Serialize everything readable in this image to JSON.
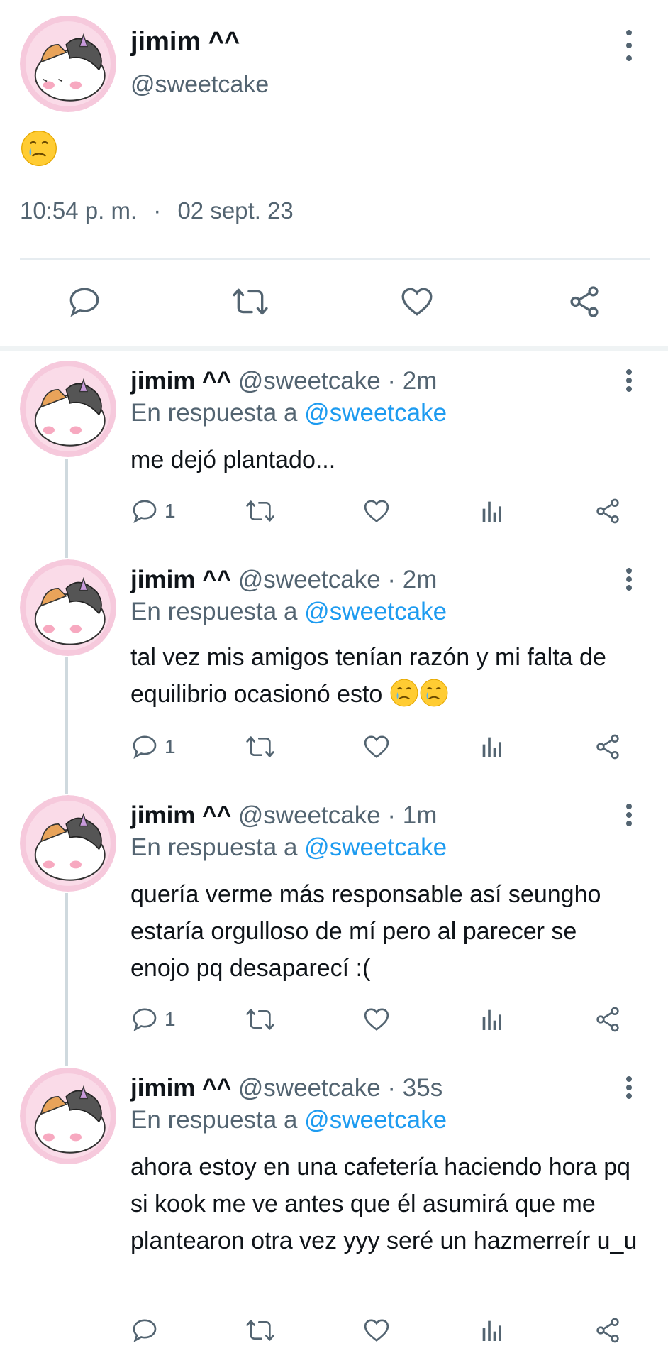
{
  "main_tweet": {
    "display_name": "jimim ^^",
    "handle": "@sweetcake",
    "body_emoji": "face-holding-back-tears-emoji",
    "time": "10:54 p. m.",
    "separator": "·",
    "date": "02 sept. 23",
    "actions": [
      "reply-icon",
      "retweet-icon",
      "like-icon",
      "share-icon"
    ]
  },
  "replies": [
    {
      "display_name": "jimim ^^",
      "handle": "@sweetcake",
      "time": "· 2m",
      "reply_prefix": "En respuesta a",
      "reply_to": "@sweetcake",
      "text": "me dejó plantado...",
      "reply_count": "1"
    },
    {
      "display_name": "jimim ^^",
      "handle": "@sweetcake",
      "time": "· 2m",
      "reply_prefix": "En respuesta a",
      "reply_to": "@sweetcake",
      "text": "tal vez mis amigos tenían razón y mi falta de equilibrio ocasionó esto",
      "reply_count": "1"
    },
    {
      "display_name": "jimim ^^",
      "handle": "@sweetcake",
      "time": "· 1m",
      "reply_prefix": "En respuesta a",
      "reply_to": "@sweetcake",
      "text": "quería verme más responsable así seungho estaría orgulloso de mí pero al parecer se enojo pq desaparecí :(",
      "reply_count": "1"
    },
    {
      "display_name": "jimim ^^",
      "handle": "@sweetcake",
      "time": "· 35s",
      "reply_prefix": "En respuesta a",
      "reply_to": "@sweetcake",
      "text": "ahora estoy en una cafetería haciendo hora pq si kook me ve antes que él asumirá que me plantearon otra vez yyy seré un hazmerreír u_u",
      "reply_count": ""
    }
  ],
  "colors": {
    "link": "#1d9bf0",
    "secondary_text": "#536471",
    "primary_text": "#0f1419",
    "avatar_bg": "#f6c9dc",
    "thread_line": "#cfd9de"
  }
}
